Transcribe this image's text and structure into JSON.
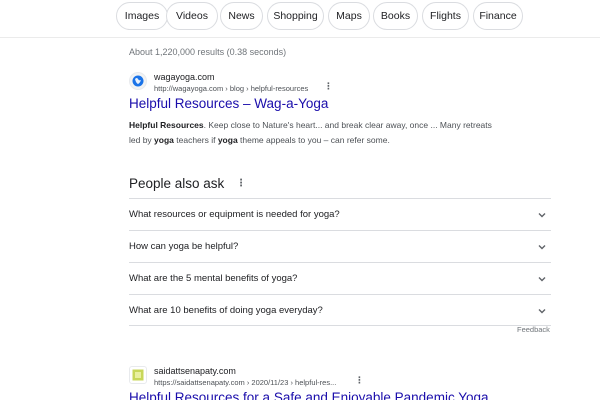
{
  "chips": [
    "Images",
    "Videos",
    "News",
    "Shopping",
    "Maps",
    "Books",
    "Flights",
    "Finance"
  ],
  "stats": "About 1,220,000 results (0.38 seconds)",
  "results": [
    {
      "site_name": "wagayoga.com",
      "url": "http://wagayoga.com › blog › helpful-resources",
      "title": "Helpful Resources – Wag-a-Yoga",
      "snippet_line1_bold": "Helpful Resources",
      "snippet_line1_rest": ". Keep close to Nature's heart... and break clear away, once ... Many retreats",
      "snippet_line2_pre": "led by ",
      "snippet_line2_b1": "yoga",
      "snippet_line2_mid": " teachers if ",
      "snippet_line2_b2": "yoga",
      "snippet_line2_post": " theme appeals to you – can refer some.",
      "favicon": "globe-icon"
    },
    {
      "site_name": "saidattsenapaty.com",
      "url": "https://saidattsenapaty.com › 2020/11/23 › helpful-res...",
      "title": "Helpful Resources for a Safe and Enjoyable Pandemic Yoga",
      "favicon": "square-favicon-icon"
    }
  ],
  "people_also_ask": {
    "heading": "People also ask",
    "questions": [
      "What resources or equipment is needed for yoga?",
      "How can yoga be helpful?",
      "What are the 5 mental benefits of yoga?",
      "What are 10 benefits of doing yoga everyday?"
    ],
    "feedback": "Feedback"
  },
  "kebab_glyph": "⋮",
  "colors": {
    "link": "#1a0dab",
    "text": "#202124",
    "muted": "#70757a",
    "border": "#dadce0"
  }
}
